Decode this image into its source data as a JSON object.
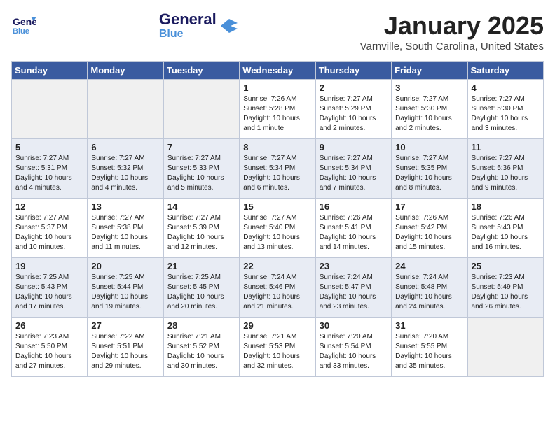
{
  "header": {
    "logo_general": "General",
    "logo_blue": "Blue",
    "month_title": "January 2025",
    "location": "Varnville, South Carolina, United States"
  },
  "weekdays": [
    "Sunday",
    "Monday",
    "Tuesday",
    "Wednesday",
    "Thursday",
    "Friday",
    "Saturday"
  ],
  "weeks": [
    {
      "alt": false,
      "days": [
        {
          "num": "",
          "info": ""
        },
        {
          "num": "",
          "info": ""
        },
        {
          "num": "",
          "info": ""
        },
        {
          "num": "1",
          "info": "Sunrise: 7:26 AM\nSunset: 5:28 PM\nDaylight: 10 hours\nand 1 minute."
        },
        {
          "num": "2",
          "info": "Sunrise: 7:27 AM\nSunset: 5:29 PM\nDaylight: 10 hours\nand 2 minutes."
        },
        {
          "num": "3",
          "info": "Sunrise: 7:27 AM\nSunset: 5:30 PM\nDaylight: 10 hours\nand 2 minutes."
        },
        {
          "num": "4",
          "info": "Sunrise: 7:27 AM\nSunset: 5:30 PM\nDaylight: 10 hours\nand 3 minutes."
        }
      ]
    },
    {
      "alt": true,
      "days": [
        {
          "num": "5",
          "info": "Sunrise: 7:27 AM\nSunset: 5:31 PM\nDaylight: 10 hours\nand 4 minutes."
        },
        {
          "num": "6",
          "info": "Sunrise: 7:27 AM\nSunset: 5:32 PM\nDaylight: 10 hours\nand 4 minutes."
        },
        {
          "num": "7",
          "info": "Sunrise: 7:27 AM\nSunset: 5:33 PM\nDaylight: 10 hours\nand 5 minutes."
        },
        {
          "num": "8",
          "info": "Sunrise: 7:27 AM\nSunset: 5:34 PM\nDaylight: 10 hours\nand 6 minutes."
        },
        {
          "num": "9",
          "info": "Sunrise: 7:27 AM\nSunset: 5:34 PM\nDaylight: 10 hours\nand 7 minutes."
        },
        {
          "num": "10",
          "info": "Sunrise: 7:27 AM\nSunset: 5:35 PM\nDaylight: 10 hours\nand 8 minutes."
        },
        {
          "num": "11",
          "info": "Sunrise: 7:27 AM\nSunset: 5:36 PM\nDaylight: 10 hours\nand 9 minutes."
        }
      ]
    },
    {
      "alt": false,
      "days": [
        {
          "num": "12",
          "info": "Sunrise: 7:27 AM\nSunset: 5:37 PM\nDaylight: 10 hours\nand 10 minutes."
        },
        {
          "num": "13",
          "info": "Sunrise: 7:27 AM\nSunset: 5:38 PM\nDaylight: 10 hours\nand 11 minutes."
        },
        {
          "num": "14",
          "info": "Sunrise: 7:27 AM\nSunset: 5:39 PM\nDaylight: 10 hours\nand 12 minutes."
        },
        {
          "num": "15",
          "info": "Sunrise: 7:27 AM\nSunset: 5:40 PM\nDaylight: 10 hours\nand 13 minutes."
        },
        {
          "num": "16",
          "info": "Sunrise: 7:26 AM\nSunset: 5:41 PM\nDaylight: 10 hours\nand 14 minutes."
        },
        {
          "num": "17",
          "info": "Sunrise: 7:26 AM\nSunset: 5:42 PM\nDaylight: 10 hours\nand 15 minutes."
        },
        {
          "num": "18",
          "info": "Sunrise: 7:26 AM\nSunset: 5:43 PM\nDaylight: 10 hours\nand 16 minutes."
        }
      ]
    },
    {
      "alt": true,
      "days": [
        {
          "num": "19",
          "info": "Sunrise: 7:25 AM\nSunset: 5:43 PM\nDaylight: 10 hours\nand 17 minutes."
        },
        {
          "num": "20",
          "info": "Sunrise: 7:25 AM\nSunset: 5:44 PM\nDaylight: 10 hours\nand 19 minutes."
        },
        {
          "num": "21",
          "info": "Sunrise: 7:25 AM\nSunset: 5:45 PM\nDaylight: 10 hours\nand 20 minutes."
        },
        {
          "num": "22",
          "info": "Sunrise: 7:24 AM\nSunset: 5:46 PM\nDaylight: 10 hours\nand 21 minutes."
        },
        {
          "num": "23",
          "info": "Sunrise: 7:24 AM\nSunset: 5:47 PM\nDaylight: 10 hours\nand 23 minutes."
        },
        {
          "num": "24",
          "info": "Sunrise: 7:24 AM\nSunset: 5:48 PM\nDaylight: 10 hours\nand 24 minutes."
        },
        {
          "num": "25",
          "info": "Sunrise: 7:23 AM\nSunset: 5:49 PM\nDaylight: 10 hours\nand 26 minutes."
        }
      ]
    },
    {
      "alt": false,
      "days": [
        {
          "num": "26",
          "info": "Sunrise: 7:23 AM\nSunset: 5:50 PM\nDaylight: 10 hours\nand 27 minutes."
        },
        {
          "num": "27",
          "info": "Sunrise: 7:22 AM\nSunset: 5:51 PM\nDaylight: 10 hours\nand 29 minutes."
        },
        {
          "num": "28",
          "info": "Sunrise: 7:21 AM\nSunset: 5:52 PM\nDaylight: 10 hours\nand 30 minutes."
        },
        {
          "num": "29",
          "info": "Sunrise: 7:21 AM\nSunset: 5:53 PM\nDaylight: 10 hours\nand 32 minutes."
        },
        {
          "num": "30",
          "info": "Sunrise: 7:20 AM\nSunset: 5:54 PM\nDaylight: 10 hours\nand 33 minutes."
        },
        {
          "num": "31",
          "info": "Sunrise: 7:20 AM\nSunset: 5:55 PM\nDaylight: 10 hours\nand 35 minutes."
        },
        {
          "num": "",
          "info": ""
        }
      ]
    }
  ]
}
